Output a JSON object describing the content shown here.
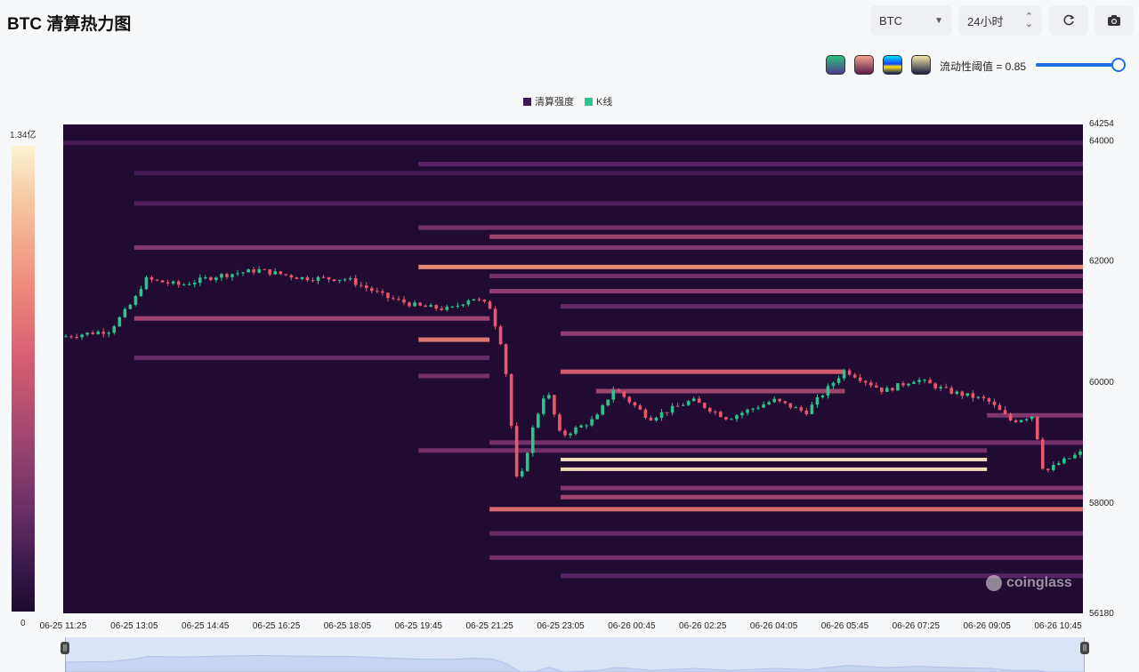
{
  "title": "BTC 清算热力图",
  "controls": {
    "symbol": "BTC",
    "range": "24小时",
    "threshold_label": "流动性阈值 = 0.85",
    "threshold_value": 0.85
  },
  "colors": {
    "heat_bg": "#220b33",
    "candle_up": "#2bc48a",
    "candle_down": "#e8576b",
    "accent": "#1f6fe0"
  },
  "legend": [
    {
      "label": "清算强度",
      "color": "#3b1a55"
    },
    {
      "label": "K线",
      "color": "#2bc48a"
    }
  ],
  "color_scale": {
    "max_label": "1.34亿",
    "min_label": "0"
  },
  "watermark": "coinglass",
  "chart_data": {
    "type": "heatmap",
    "title": "BTC 清算热力图",
    "x_ticks": [
      "06-25 11:25",
      "06-25 13:05",
      "06-25 14:45",
      "06-25 16:25",
      "06-25 18:05",
      "06-25 19:45",
      "06-25 21:25",
      "06-25 23:05",
      "06-26 00:45",
      "06-26 02:25",
      "06-26 04:05",
      "06-26 05:45",
      "06-26 07:25",
      "06-26 09:05",
      "06-26 10:45"
    ],
    "y_ticks": [
      64254,
      64000,
      62000,
      60000,
      58000,
      56180
    ],
    "ylim": [
      56180,
      64254
    ],
    "xlim": [
      "06-25 11:25",
      "06-26 11:20"
    ],
    "bands": [
      {
        "price": 63950,
        "start": "06-25 11:25",
        "end": "06-26 11:20",
        "intensity": 0.15
      },
      {
        "price": 63600,
        "start": "06-25 19:45",
        "end": "06-26 11:20",
        "intensity": 0.25
      },
      {
        "price": 63450,
        "start": "06-25 13:05",
        "end": "06-26 11:20",
        "intensity": 0.15
      },
      {
        "price": 62950,
        "start": "06-25 13:05",
        "end": "06-26 11:20",
        "intensity": 0.22
      },
      {
        "price": 62550,
        "start": "06-25 19:45",
        "end": "06-26 11:20",
        "intensity": 0.35
      },
      {
        "price": 62400,
        "start": "06-25 21:25",
        "end": "06-26 11:20",
        "intensity": 0.5
      },
      {
        "price": 62220,
        "start": "06-25 13:05",
        "end": "06-26 11:20",
        "intensity": 0.4
      },
      {
        "price": 61900,
        "start": "06-25 19:45",
        "end": "06-26 11:20",
        "intensity": 0.8
      },
      {
        "price": 61750,
        "start": "06-25 21:25",
        "end": "06-26 11:20",
        "intensity": 0.35
      },
      {
        "price": 61500,
        "start": "06-25 21:25",
        "end": "06-26 11:20",
        "intensity": 0.45
      },
      {
        "price": 61250,
        "start": "06-25 23:05",
        "end": "06-26 11:20",
        "intensity": 0.3
      },
      {
        "price": 61050,
        "start": "06-25 13:05",
        "end": "06-25 21:25",
        "intensity": 0.5
      },
      {
        "price": 60800,
        "start": "06-25 23:05",
        "end": "06-26 11:20",
        "intensity": 0.45
      },
      {
        "price": 60700,
        "start": "06-25 19:45",
        "end": "06-25 21:25",
        "intensity": 0.75
      },
      {
        "price": 60400,
        "start": "06-25 13:05",
        "end": "06-25 21:25",
        "intensity": 0.3
      },
      {
        "price": 60170,
        "start": "06-25 23:05",
        "end": "06-26 05:45",
        "intensity": 0.65
      },
      {
        "price": 60100,
        "start": "06-25 19:45",
        "end": "06-25 21:25",
        "intensity": 0.35
      },
      {
        "price": 59850,
        "start": "06-25 23:55",
        "end": "06-26 05:45",
        "intensity": 0.5
      },
      {
        "price": 59450,
        "start": "06-26 09:05",
        "end": "06-26 11:20",
        "intensity": 0.4
      },
      {
        "price": 59000,
        "start": "06-25 21:25",
        "end": "06-26 11:20",
        "intensity": 0.35
      },
      {
        "price": 58870,
        "start": "06-25 19:45",
        "end": "06-26 09:05",
        "intensity": 0.35
      },
      {
        "price": 58720,
        "start": "06-25 23:05",
        "end": "06-26 09:05",
        "intensity": 0.98
      },
      {
        "price": 58560,
        "start": "06-25 23:05",
        "end": "06-26 09:05",
        "intensity": 0.98
      },
      {
        "price": 58250,
        "start": "06-25 23:05",
        "end": "06-26 11:20",
        "intensity": 0.4
      },
      {
        "price": 58100,
        "start": "06-25 23:05",
        "end": "06-26 11:20",
        "intensity": 0.5
      },
      {
        "price": 57900,
        "start": "06-25 21:25",
        "end": "06-26 11:20",
        "intensity": 0.7
      },
      {
        "price": 57500,
        "start": "06-25 21:25",
        "end": "06-26 11:20",
        "intensity": 0.3
      },
      {
        "price": 57100,
        "start": "06-25 21:25",
        "end": "06-26 11:20",
        "intensity": 0.35
      },
      {
        "price": 56800,
        "start": "06-25 23:05",
        "end": "06-26 11:20",
        "intensity": 0.25
      }
    ],
    "price_series": [
      {
        "t": "06-25 11:25",
        "p": 60750
      },
      {
        "t": "06-25 12:30",
        "p": 60850
      },
      {
        "t": "06-25 13:05",
        "p": 61350
      },
      {
        "t": "06-25 13:20",
        "p": 61700
      },
      {
        "t": "06-25 14:10",
        "p": 61600
      },
      {
        "t": "06-25 15:00",
        "p": 61750
      },
      {
        "t": "06-25 16:00",
        "p": 61850
      },
      {
        "t": "06-25 17:00",
        "p": 61720
      },
      {
        "t": "06-25 18:05",
        "p": 61700
      },
      {
        "t": "06-25 19:00",
        "p": 61400
      },
      {
        "t": "06-25 19:45",
        "p": 61250
      },
      {
        "t": "06-25 20:30",
        "p": 61200
      },
      {
        "t": "06-25 21:00",
        "p": 61400
      },
      {
        "t": "06-25 21:25",
        "p": 61250
      },
      {
        "t": "06-25 21:45",
        "p": 60500
      },
      {
        "t": "06-25 22:05",
        "p": 58200
      },
      {
        "t": "06-25 22:25",
        "p": 59200
      },
      {
        "t": "06-25 22:45",
        "p": 59900
      },
      {
        "t": "06-25 23:05",
        "p": 59100
      },
      {
        "t": "06-25 23:55",
        "p": 59400
      },
      {
        "t": "06-26 00:20",
        "p": 59900
      },
      {
        "t": "06-26 01:10",
        "p": 59400
      },
      {
        "t": "06-26 02:10",
        "p": 59700
      },
      {
        "t": "06-26 03:00",
        "p": 59400
      },
      {
        "t": "06-26 04:05",
        "p": 59700
      },
      {
        "t": "06-26 04:50",
        "p": 59500
      },
      {
        "t": "06-26 05:45",
        "p": 60200
      },
      {
        "t": "06-26 06:40",
        "p": 59850
      },
      {
        "t": "06-26 07:25",
        "p": 60050
      },
      {
        "t": "06-26 08:10",
        "p": 59850
      },
      {
        "t": "06-26 09:05",
        "p": 59700
      },
      {
        "t": "06-26 09:40",
        "p": 59350
      },
      {
        "t": "06-26 10:10",
        "p": 59450
      },
      {
        "t": "06-26 10:25",
        "p": 58500
      },
      {
        "t": "06-26 10:45",
        "p": 58650
      },
      {
        "t": "06-26 11:20",
        "p": 58850
      }
    ]
  }
}
